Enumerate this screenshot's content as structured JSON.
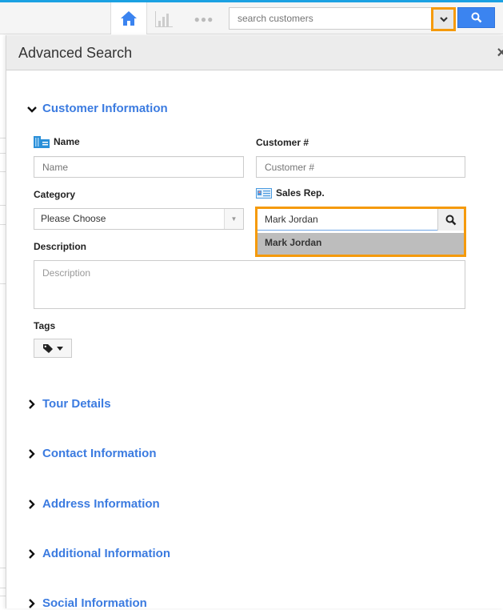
{
  "topbar": {
    "home_icon": "home-icon",
    "chart_icon": "bar-chart-icon",
    "more_icon": "ellipsis-icon",
    "more_glyph": "●●●",
    "search_placeholder": "search customers",
    "search_dropdown_icon": "chevron-down-icon",
    "search_button_icon": "search-icon",
    "accent_color": "#3b84f0",
    "highlight_color": "#f59a0b"
  },
  "panel": {
    "title": "Advanced Search",
    "close_glyph": "×",
    "sections": [
      {
        "label": "Customer Information",
        "expanded": true,
        "chevron": "▾"
      },
      {
        "label": "Tour Details",
        "expanded": false,
        "chevron": "›"
      },
      {
        "label": "Contact Information",
        "expanded": false,
        "chevron": "›"
      },
      {
        "label": "Address Information",
        "expanded": false,
        "chevron": "›"
      },
      {
        "label": "Additional Information",
        "expanded": false,
        "chevron": "›"
      },
      {
        "label": "Social Information",
        "expanded": false,
        "chevron": "›"
      }
    ],
    "fields": {
      "name": {
        "label": "Name",
        "placeholder": "Name",
        "icon": "building-icon"
      },
      "customer_no": {
        "label": "Customer #",
        "placeholder": "Customer #"
      },
      "category": {
        "label": "Category",
        "selected": "Please Choose"
      },
      "sales_rep": {
        "label": "Sales Rep.",
        "value": "Mark Jordan",
        "icon": "id-card-icon",
        "suggestions": [
          "Mark Jordan"
        ]
      },
      "description": {
        "label": "Description",
        "placeholder": "Description"
      },
      "tags": {
        "label": "Tags",
        "icon": "tag-icon"
      }
    }
  }
}
